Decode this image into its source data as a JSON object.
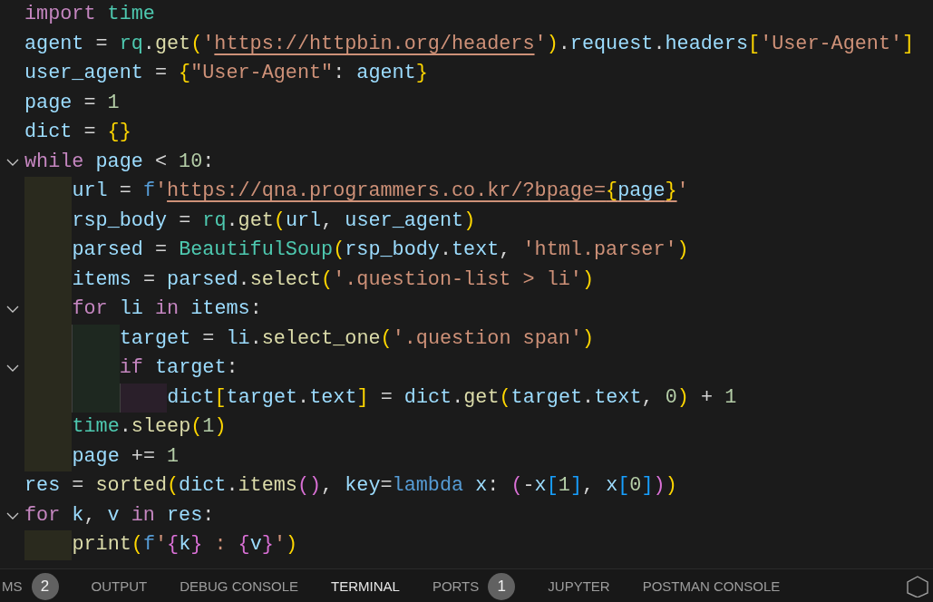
{
  "code": [
    {
      "tokens": [
        {
          "text": "import ",
          "kind": "kw"
        },
        {
          "text": "time",
          "kind": "cls"
        }
      ]
    },
    {
      "tokens": [
        {
          "text": "agent",
          "kind": "var"
        },
        {
          "text": " = ",
          "kind": "plain"
        },
        {
          "text": "rq",
          "kind": "cls"
        },
        {
          "text": ".",
          "kind": "plain"
        },
        {
          "text": "get",
          "kind": "fn"
        },
        {
          "text": "(",
          "kind": "b1"
        },
        {
          "text": "'",
          "kind": "str"
        },
        {
          "text": "https://httpbin.org/headers",
          "kind": "link"
        },
        {
          "text": "'",
          "kind": "str"
        },
        {
          "text": ")",
          "kind": "b1"
        },
        {
          "text": ".",
          "kind": "plain"
        },
        {
          "text": "request",
          "kind": "var"
        },
        {
          "text": ".",
          "kind": "plain"
        },
        {
          "text": "headers",
          "kind": "var"
        },
        {
          "text": "[",
          "kind": "b1"
        },
        {
          "text": "'User-Agent'",
          "kind": "str"
        },
        {
          "text": "]",
          "kind": "b1"
        }
      ]
    },
    {
      "tokens": [
        {
          "text": "user_agent",
          "kind": "var"
        },
        {
          "text": " = ",
          "kind": "plain"
        },
        {
          "text": "{",
          "kind": "b1"
        },
        {
          "text": "\"User-Agent\"",
          "kind": "str"
        },
        {
          "text": ": ",
          "kind": "plain"
        },
        {
          "text": "agent",
          "kind": "var"
        },
        {
          "text": "}",
          "kind": "b1"
        }
      ]
    },
    {
      "tokens": [
        {
          "text": "page",
          "kind": "var"
        },
        {
          "text": " = ",
          "kind": "plain"
        },
        {
          "text": "1",
          "kind": "num"
        }
      ]
    },
    {
      "tokens": [
        {
          "text": "dict",
          "kind": "var"
        },
        {
          "text": " = ",
          "kind": "plain"
        },
        {
          "text": "{",
          "kind": "b1"
        },
        {
          "text": "}",
          "kind": "b1"
        }
      ]
    },
    {
      "tokens": [
        {
          "text": "while ",
          "kind": "kw"
        },
        {
          "text": "page",
          "kind": "var"
        },
        {
          "text": " < ",
          "kind": "plain"
        },
        {
          "text": "10",
          "kind": "num"
        },
        {
          "text": ":",
          "kind": "plain"
        }
      ],
      "expanded": true,
      "children": [
        {
          "tokens": [
            {
              "text": "url",
              "kind": "var"
            },
            {
              "text": " = ",
              "kind": "plain"
            },
            {
              "text": "f",
              "kind": "kw2"
            },
            {
              "text": "'",
              "kind": "str"
            },
            {
              "text": "https://qna.programmers.co.kr/?bpage=",
              "kind": "link"
            },
            {
              "text": "{",
              "kind": "link-b1"
            },
            {
              "text": "page",
              "kind": "link-var"
            },
            {
              "text": "}",
              "kind": "link-b1"
            },
            {
              "text": "'",
              "kind": "str"
            }
          ]
        },
        {
          "tokens": [
            {
              "text": "rsp_body",
              "kind": "var"
            },
            {
              "text": " = ",
              "kind": "plain"
            },
            {
              "text": "rq",
              "kind": "cls"
            },
            {
              "text": ".",
              "kind": "plain"
            },
            {
              "text": "get",
              "kind": "fn"
            },
            {
              "text": "(",
              "kind": "b1"
            },
            {
              "text": "url",
              "kind": "var"
            },
            {
              "text": ", ",
              "kind": "plain"
            },
            {
              "text": "user_agent",
              "kind": "var"
            },
            {
              "text": ")",
              "kind": "b1"
            }
          ]
        },
        {
          "tokens": [
            {
              "text": "parsed",
              "kind": "var"
            },
            {
              "text": " = ",
              "kind": "plain"
            },
            {
              "text": "BeautifulSoup",
              "kind": "cls"
            },
            {
              "text": "(",
              "kind": "b1"
            },
            {
              "text": "rsp_body",
              "kind": "var"
            },
            {
              "text": ".",
              "kind": "plain"
            },
            {
              "text": "text",
              "kind": "var"
            },
            {
              "text": ", ",
              "kind": "plain"
            },
            {
              "text": "'html.parser'",
              "kind": "str"
            },
            {
              "text": ")",
              "kind": "b1"
            }
          ]
        },
        {
          "tokens": [
            {
              "text": "items",
              "kind": "var"
            },
            {
              "text": " = ",
              "kind": "plain"
            },
            {
              "text": "parsed",
              "kind": "var"
            },
            {
              "text": ".",
              "kind": "plain"
            },
            {
              "text": "select",
              "kind": "fn"
            },
            {
              "text": "(",
              "kind": "b1"
            },
            {
              "text": "'.question-list > li'",
              "kind": "str"
            },
            {
              "text": ")",
              "kind": "b1"
            }
          ]
        },
        {
          "tokens": [
            {
              "text": "for ",
              "kind": "kw"
            },
            {
              "text": "li ",
              "kind": "var"
            },
            {
              "text": "in ",
              "kind": "kw"
            },
            {
              "text": "items",
              "kind": "var"
            },
            {
              "text": ":",
              "kind": "plain"
            }
          ],
          "expanded": true,
          "children": [
            {
              "tokens": [
                {
                  "text": "target",
                  "kind": "var"
                },
                {
                  "text": " = ",
                  "kind": "plain"
                },
                {
                  "text": "li",
                  "kind": "var"
                },
                {
                  "text": ".",
                  "kind": "plain"
                },
                {
                  "text": "select_one",
                  "kind": "fn"
                },
                {
                  "text": "(",
                  "kind": "b1"
                },
                {
                  "text": "'.question span'",
                  "kind": "str"
                },
                {
                  "text": ")",
                  "kind": "b1"
                }
              ]
            },
            {
              "tokens": [
                {
                  "text": "if ",
                  "kind": "kw"
                },
                {
                  "text": "target",
                  "kind": "var"
                },
                {
                  "text": ":",
                  "kind": "plain"
                }
              ],
              "expanded": true,
              "children": [
                {
                  "tokens": [
                    {
                      "text": "dict",
                      "kind": "var"
                    },
                    {
                      "text": "[",
                      "kind": "b1"
                    },
                    {
                      "text": "target",
                      "kind": "var"
                    },
                    {
                      "text": ".",
                      "kind": "plain"
                    },
                    {
                      "text": "text",
                      "kind": "var"
                    },
                    {
                      "text": "]",
                      "kind": "b1"
                    },
                    {
                      "text": " = ",
                      "kind": "plain"
                    },
                    {
                      "text": "dict",
                      "kind": "var"
                    },
                    {
                      "text": ".",
                      "kind": "plain"
                    },
                    {
                      "text": "get",
                      "kind": "fn"
                    },
                    {
                      "text": "(",
                      "kind": "b1"
                    },
                    {
                      "text": "target",
                      "kind": "var"
                    },
                    {
                      "text": ".",
                      "kind": "plain"
                    },
                    {
                      "text": "text",
                      "kind": "var"
                    },
                    {
                      "text": ", ",
                      "kind": "plain"
                    },
                    {
                      "text": "0",
                      "kind": "num"
                    },
                    {
                      "text": ")",
                      "kind": "b1"
                    },
                    {
                      "text": " + ",
                      "kind": "plain"
                    },
                    {
                      "text": "1",
                      "kind": "num"
                    }
                  ]
                }
              ]
            }
          ]
        },
        {
          "tokens": [
            {
              "text": "time",
              "kind": "cls"
            },
            {
              "text": ".",
              "kind": "plain"
            },
            {
              "text": "sleep",
              "kind": "fn"
            },
            {
              "text": "(",
              "kind": "b1"
            },
            {
              "text": "1",
              "kind": "num"
            },
            {
              "text": ")",
              "kind": "b1"
            }
          ]
        },
        {
          "tokens": [
            {
              "text": "page",
              "kind": "var"
            },
            {
              "text": " += ",
              "kind": "plain"
            },
            {
              "text": "1",
              "kind": "num"
            }
          ]
        }
      ]
    },
    {
      "tokens": [
        {
          "text": "res",
          "kind": "var"
        },
        {
          "text": " = ",
          "kind": "plain"
        },
        {
          "text": "sorted",
          "kind": "fn"
        },
        {
          "text": "(",
          "kind": "b1"
        },
        {
          "text": "dict",
          "kind": "var"
        },
        {
          "text": ".",
          "kind": "plain"
        },
        {
          "text": "items",
          "kind": "fn"
        },
        {
          "text": "()",
          "kind": "b2"
        },
        {
          "text": ", ",
          "kind": "plain"
        },
        {
          "text": "key",
          "kind": "var"
        },
        {
          "text": "=",
          "kind": "plain"
        },
        {
          "text": "lambda ",
          "kind": "kw2"
        },
        {
          "text": "x",
          "kind": "var"
        },
        {
          "text": ": ",
          "kind": "plain"
        },
        {
          "text": "(",
          "kind": "b2"
        },
        {
          "text": "-",
          "kind": "plain"
        },
        {
          "text": "x",
          "kind": "var"
        },
        {
          "text": "[",
          "kind": "b3"
        },
        {
          "text": "1",
          "kind": "num"
        },
        {
          "text": "]",
          "kind": "b3"
        },
        {
          "text": ", ",
          "kind": "plain"
        },
        {
          "text": "x",
          "kind": "var"
        },
        {
          "text": "[",
          "kind": "b3"
        },
        {
          "text": "0",
          "kind": "num"
        },
        {
          "text": "]",
          "kind": "b3"
        },
        {
          "text": ")",
          "kind": "b2"
        },
        {
          "text": ")",
          "kind": "b1"
        }
      ]
    },
    {
      "tokens": [
        {
          "text": "for ",
          "kind": "kw"
        },
        {
          "text": "k",
          "kind": "var"
        },
        {
          "text": ", ",
          "kind": "plain"
        },
        {
          "text": "v ",
          "kind": "var"
        },
        {
          "text": "in ",
          "kind": "kw"
        },
        {
          "text": "res",
          "kind": "var"
        },
        {
          "text": ":",
          "kind": "plain"
        }
      ],
      "expanded": true,
      "children": [
        {
          "tokens": [
            {
              "text": "print",
              "kind": "fn"
            },
            {
              "text": "(",
              "kind": "b1"
            },
            {
              "text": "f",
              "kind": "kw2"
            },
            {
              "text": "'",
              "kind": "str"
            },
            {
              "text": "{",
              "kind": "b2"
            },
            {
              "text": "k",
              "kind": "var"
            },
            {
              "text": "}",
              "kind": "b2"
            },
            {
              "text": " : ",
              "kind": "str"
            },
            {
              "text": "{",
              "kind": "b2"
            },
            {
              "text": "v",
              "kind": "var"
            },
            {
              "text": "}",
              "kind": "b2"
            },
            {
              "text": "'",
              "kind": "str"
            },
            {
              "text": ")",
              "kind": "b1"
            }
          ]
        }
      ]
    }
  ],
  "panel_tabs": [
    {
      "label": "MS",
      "selected": false,
      "badge": "2"
    },
    {
      "label": "OUTPUT",
      "selected": false
    },
    {
      "label": "DEBUG CONSOLE",
      "selected": false
    },
    {
      "label": "TERMINAL",
      "selected": true
    },
    {
      "label": "PORTS",
      "selected": false,
      "badge": "1"
    },
    {
      "label": "JUPYTER",
      "selected": false
    },
    {
      "label": "POSTMAN CONSOLE",
      "selected": false
    }
  ]
}
